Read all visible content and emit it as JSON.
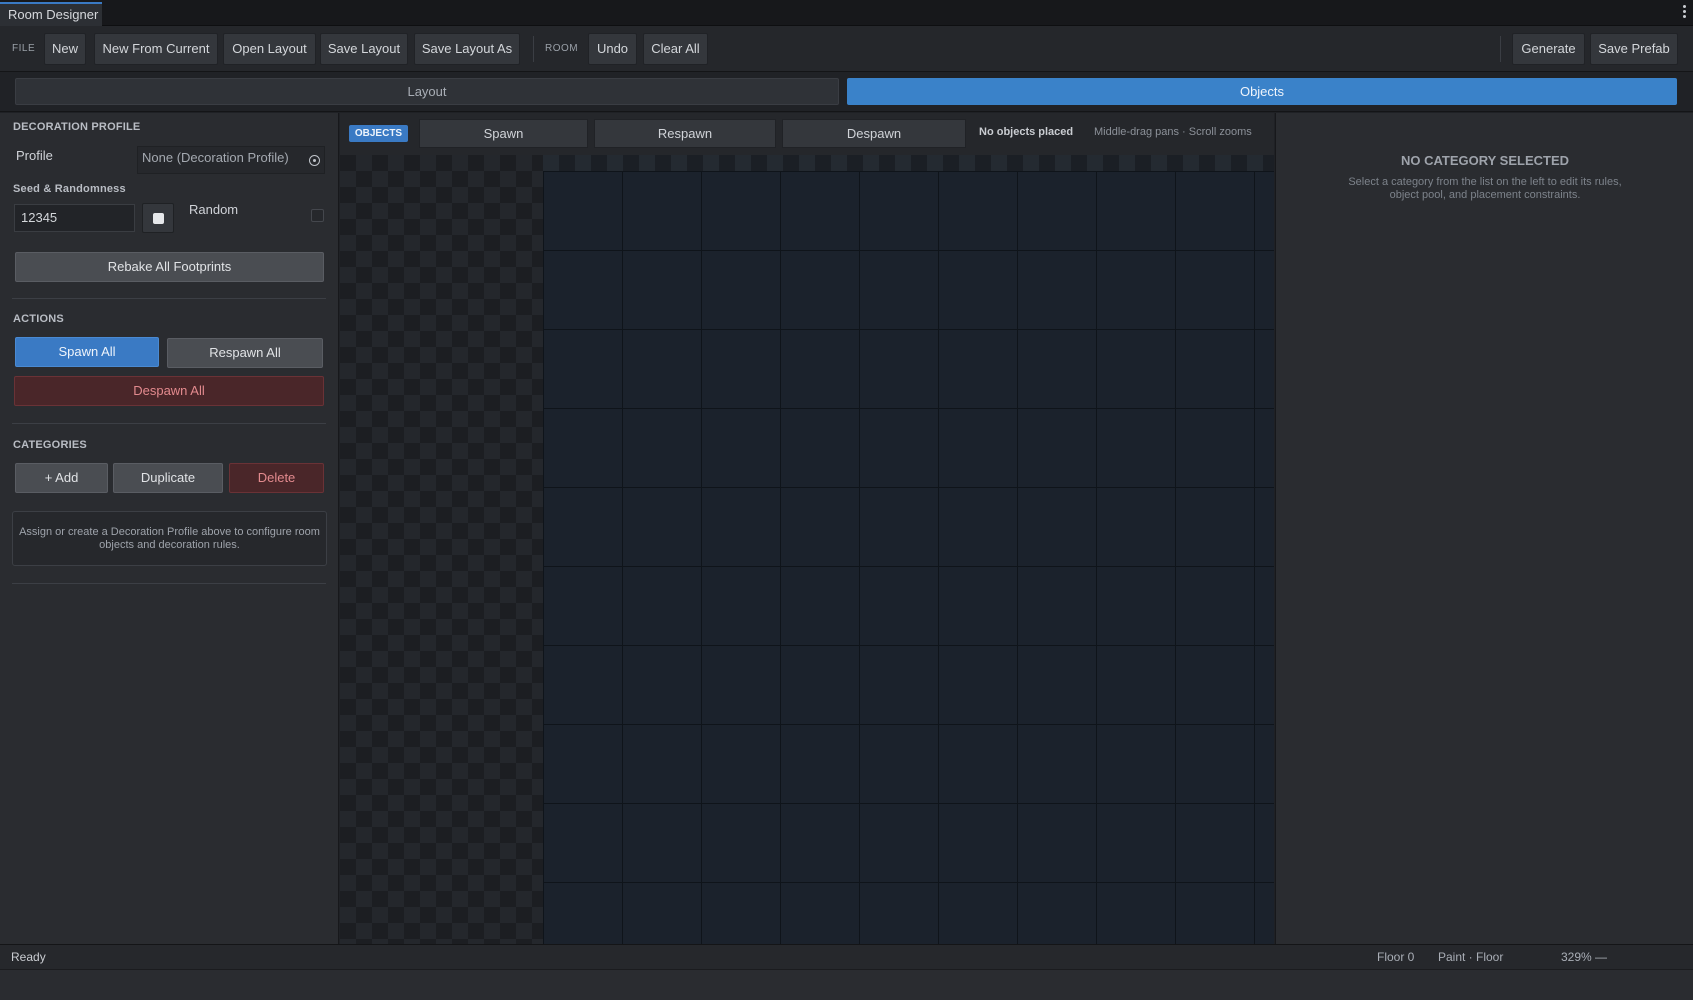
{
  "window": {
    "tab_title": "Room Designer"
  },
  "toolbar": {
    "file_label": "FILE",
    "new": "New",
    "new_from_current": "New From Current",
    "open_layout": "Open Layout",
    "save_layout": "Save Layout",
    "save_layout_as": "Save Layout As",
    "room_label": "ROOM",
    "undo": "Undo",
    "clear_all": "Clear All",
    "generate": "Generate",
    "save_prefab": "Save Prefab"
  },
  "mode_tabs": {
    "layout": "Layout",
    "objects": "Objects",
    "active": "Objects"
  },
  "left_panel": {
    "decoration_profile_title": "DECORATION PROFILE",
    "profile_label": "Profile",
    "profile_value": "None (Decoration Profile)",
    "seed_section_title": "Seed & Randomness",
    "seed_value": "12345",
    "random_label": "Random",
    "random_checked": false,
    "rebake_button": "Rebake All Footprints",
    "actions_title": "ACTIONS",
    "spawn_all": "Spawn All",
    "respawn_all": "Respawn All",
    "despawn_all": "Despawn All",
    "categories_title": "CATEGORIES",
    "add_button": "+ Add",
    "duplicate_button": "Duplicate",
    "delete_button": "Delete",
    "info_text": "Assign or create a Decoration Profile above to configure room objects and decoration rules."
  },
  "center": {
    "badge": "OBJECTS",
    "spawn": "Spawn",
    "respawn": "Respawn",
    "despawn": "Despawn",
    "status": "No objects placed",
    "hint": "Middle-drag pans · Scroll zooms"
  },
  "right_panel": {
    "title": "NO CATEGORY SELECTED",
    "description": "Select a category from the list on the left to edit its rules, object pool, and placement constraints."
  },
  "statusbar": {
    "status": "Ready",
    "floor": "Floor 0",
    "mode": "Paint · Floor",
    "zoom": "329% —"
  },
  "colors": {
    "accent": "#3a7ac4",
    "danger": "#e38a8e",
    "background": "#1f2125"
  },
  "icons": {
    "kebab": "more-vertical-icon",
    "target": "target-picker-icon",
    "dice": "dice-icon"
  }
}
